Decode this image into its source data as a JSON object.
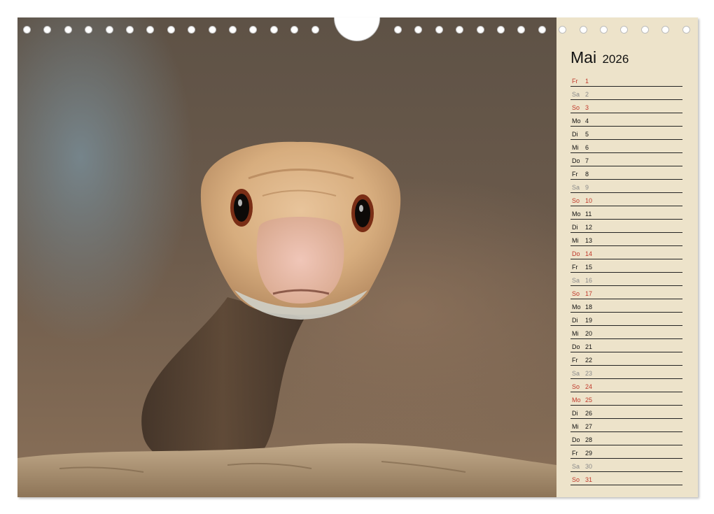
{
  "calendar": {
    "month": "Mai",
    "year": "2026",
    "days": [
      {
        "wd": "Fr",
        "d": "1",
        "type": "holiday"
      },
      {
        "wd": "Sa",
        "d": "2",
        "type": "sat"
      },
      {
        "wd": "So",
        "d": "3",
        "type": "sun"
      },
      {
        "wd": "Mo",
        "d": "4",
        "type": "week"
      },
      {
        "wd": "Di",
        "d": "5",
        "type": "week"
      },
      {
        "wd": "Mi",
        "d": "6",
        "type": "week"
      },
      {
        "wd": "Do",
        "d": "7",
        "type": "week"
      },
      {
        "wd": "Fr",
        "d": "8",
        "type": "week"
      },
      {
        "wd": "Sa",
        "d": "9",
        "type": "sat"
      },
      {
        "wd": "So",
        "d": "10",
        "type": "sun"
      },
      {
        "wd": "Mo",
        "d": "11",
        "type": "week"
      },
      {
        "wd": "Di",
        "d": "12",
        "type": "week"
      },
      {
        "wd": "Mi",
        "d": "13",
        "type": "week"
      },
      {
        "wd": "Do",
        "d": "14",
        "type": "holiday"
      },
      {
        "wd": "Fr",
        "d": "15",
        "type": "week"
      },
      {
        "wd": "Sa",
        "d": "16",
        "type": "sat"
      },
      {
        "wd": "So",
        "d": "17",
        "type": "sun"
      },
      {
        "wd": "Mo",
        "d": "18",
        "type": "week"
      },
      {
        "wd": "Di",
        "d": "19",
        "type": "week"
      },
      {
        "wd": "Mi",
        "d": "20",
        "type": "week"
      },
      {
        "wd": "Do",
        "d": "21",
        "type": "week"
      },
      {
        "wd": "Fr",
        "d": "22",
        "type": "week"
      },
      {
        "wd": "Sa",
        "d": "23",
        "type": "sat"
      },
      {
        "wd": "So",
        "d": "24",
        "type": "sun"
      },
      {
        "wd": "Mo",
        "d": "25",
        "type": "holiday"
      },
      {
        "wd": "Di",
        "d": "26",
        "type": "week"
      },
      {
        "wd": "Mi",
        "d": "27",
        "type": "week"
      },
      {
        "wd": "Do",
        "d": "28",
        "type": "week"
      },
      {
        "wd": "Fr",
        "d": "29",
        "type": "week"
      },
      {
        "wd": "Sa",
        "d": "30",
        "type": "sat"
      },
      {
        "wd": "So",
        "d": "31",
        "type": "sun"
      }
    ]
  },
  "colors": {
    "sidebar_bg": "#ede3ca",
    "sunday_holiday": "#c0392b",
    "saturday": "#8a8a8a",
    "weekday": "#111111"
  },
  "photo": {
    "icon": "snake-photo"
  }
}
